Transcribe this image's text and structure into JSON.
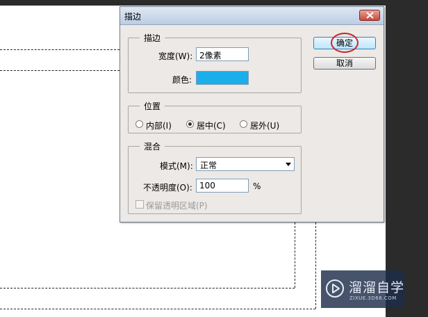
{
  "dialog": {
    "title": "描边",
    "stroke_group": {
      "title": "描边",
      "width_label": "宽度(W):",
      "width_value": "2像素",
      "color_label": "颜色:",
      "color_value": "#1aaeea"
    },
    "position_group": {
      "title": "位置",
      "options": [
        {
          "label": "内部(I)",
          "checked": false
        },
        {
          "label": "居中(C)",
          "checked": true
        },
        {
          "label": "居外(U)",
          "checked": false
        }
      ]
    },
    "blend_group": {
      "title": "混合",
      "mode_label": "模式(M):",
      "mode_value": "正常",
      "opacity_label": "不透明度(O):",
      "opacity_value": "100",
      "opacity_unit": "%",
      "preserve_label": "保留透明区域(P)",
      "preserve_checked": false
    },
    "buttons": {
      "ok": "确定",
      "cancel": "取消"
    }
  },
  "watermark": {
    "brand": "溜溜自学",
    "url": "ZIXUE.3D66.COM"
  },
  "colors": {
    "accent_ring": "#c8242a",
    "canvas_bg": "#ffffff",
    "workspace_bg": "#2b2b2b"
  }
}
